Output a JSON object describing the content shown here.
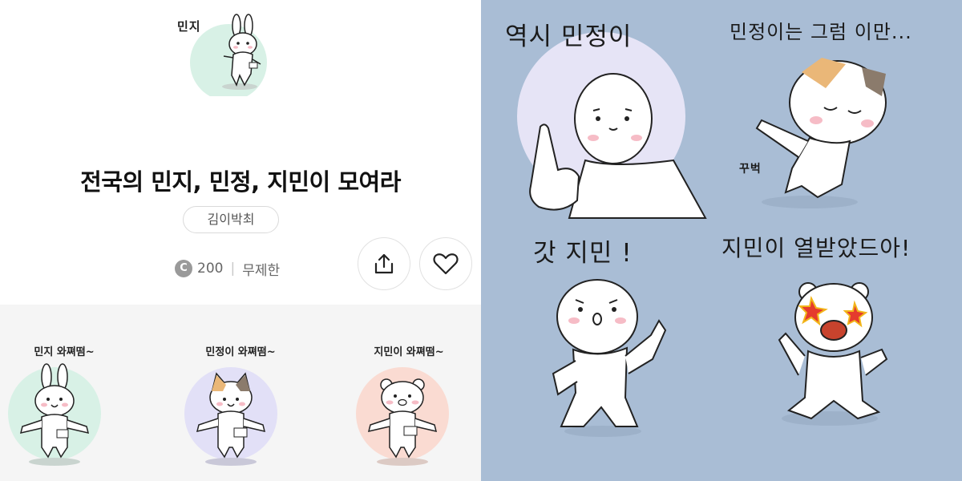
{
  "hero": {
    "label": "민지"
  },
  "pack": {
    "title": "전국의 민지, 민정, 지민이 모여라",
    "author": "김이박최",
    "coin_symbol": "C",
    "price": "200",
    "period": "무제한"
  },
  "actions": {
    "share_icon": "share-icon",
    "like_icon": "heart-icon"
  },
  "preview": {
    "items": [
      {
        "caption": "민지 와쪄떰~",
        "character": "rabbit",
        "accent": "#d8f1e6"
      },
      {
        "caption": "민정이 와쪄떰~",
        "character": "calico-cat",
        "accent": "#e2e0f7"
      },
      {
        "caption": "지민이 와쪄떰~",
        "character": "bear",
        "accent": "#fadbd2"
      }
    ]
  },
  "showcase": {
    "background": "#a9bdd5",
    "stickers": [
      {
        "caption": "역시 민정이"
      },
      {
        "caption": "민정이는 그럼 이만...",
        "sfx": "꾸벅"
      },
      {
        "caption": "갓 지민 !"
      },
      {
        "caption": "지민이 열받았드아!"
      }
    ]
  }
}
